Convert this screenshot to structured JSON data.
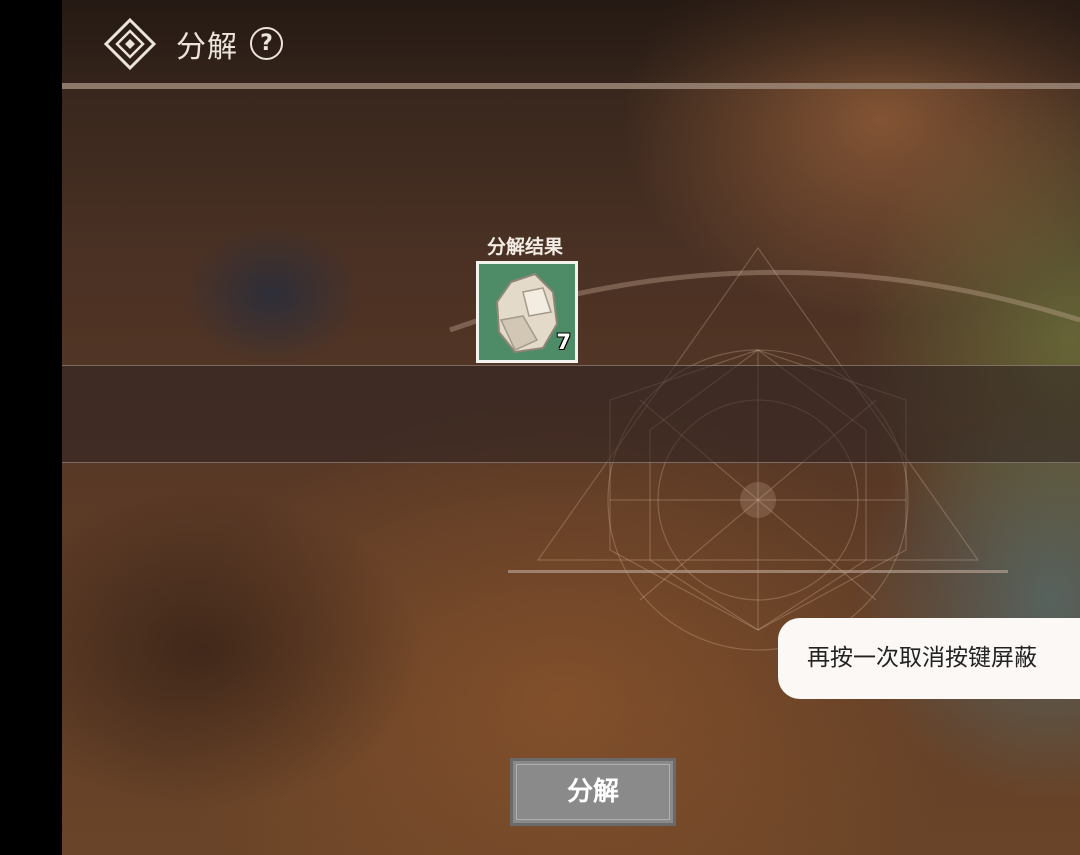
{
  "header": {
    "title": "分解",
    "logo_icon": "diamond-menu-icon",
    "help_icon": "question-mark-icon",
    "help_glyph": "?"
  },
  "result": {
    "label": "分解结果",
    "item": {
      "icon": "stone-ore-icon",
      "count": "7",
      "background_color": "#4e8b67"
    }
  },
  "toast": {
    "text": "再按一次取消按键屏蔽"
  },
  "actions": {
    "decompose_label": "分解"
  },
  "colors": {
    "left_bar": "#000000",
    "button_gray": "#8a8a8a",
    "toast_bg": "#fbf8f5"
  }
}
